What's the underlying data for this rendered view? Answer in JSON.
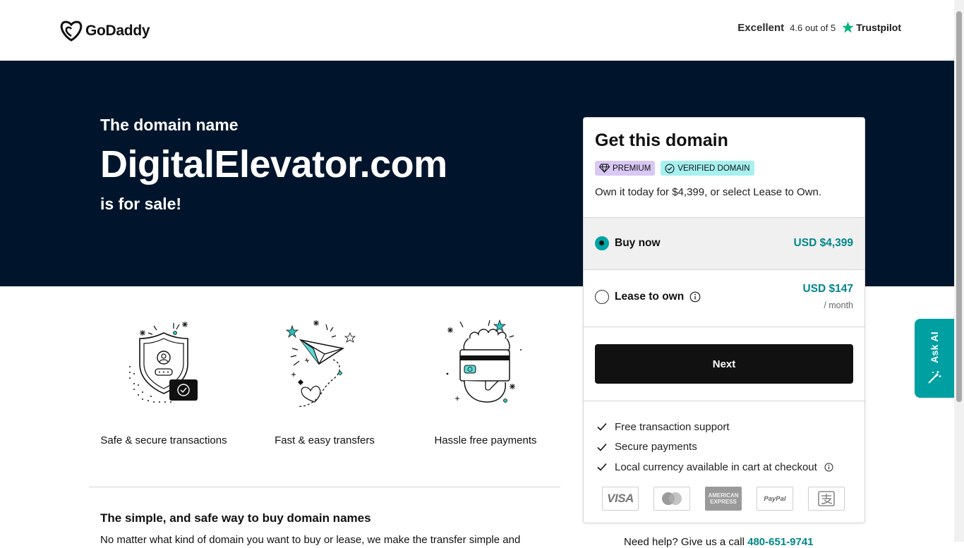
{
  "header": {
    "logo_text": "GoDaddy",
    "trust_rating": "Excellent",
    "trust_score": "4.6 out of 5",
    "trust_brand": "Trustpilot"
  },
  "hero": {
    "subtitle": "The domain name",
    "domain": "DigitalElevator.com",
    "tail": "is for sale!"
  },
  "features": [
    {
      "icon": "shield-icon",
      "caption": "Safe & secure transactions"
    },
    {
      "icon": "paper-plane-icon",
      "caption": "Fast & easy transfers"
    },
    {
      "icon": "card-payment-icon",
      "caption": "Hassle free payments"
    }
  ],
  "info": {
    "title": "The simple, and safe way to buy domain names",
    "body": "No matter what kind of domain you want to buy or lease, we make the transfer simple and"
  },
  "card": {
    "title": "Get this domain",
    "badge_premium": "PREMIUM",
    "badge_verified": "VERIFIED DOMAIN",
    "description": "Own it today for $4,399, or select Lease to Own.",
    "buy_label": "Buy now",
    "buy_price": "USD $4,399",
    "buy_selected": true,
    "lease_label": "Lease to own",
    "lease_price": "USD $147",
    "lease_unit": "/ month",
    "next_label": "Next",
    "perks": [
      "Free transaction support",
      "Secure payments",
      "Local currency available in cart at checkout"
    ],
    "payments": [
      "VISA",
      "Mastercard",
      "AMERICAN EXPRESS",
      "PayPal",
      "Alipay"
    ]
  },
  "help": {
    "text": "Need help? Give us a call",
    "phone": "480-651-9741"
  },
  "ask_ai": {
    "label": "Ask AI"
  },
  "colors": {
    "navy": "#00152c",
    "teal": "#00a4a6",
    "price_teal": "#00868a"
  }
}
